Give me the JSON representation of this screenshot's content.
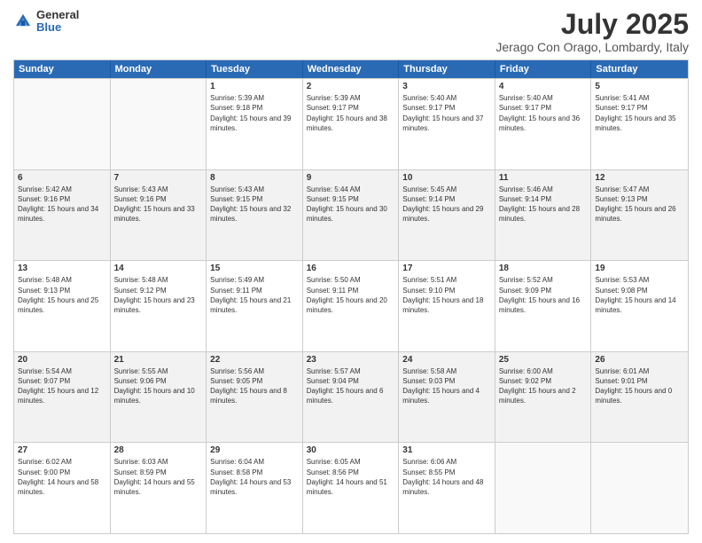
{
  "header": {
    "logo_line1": "General",
    "logo_line2": "Blue",
    "title": "July 2025",
    "subtitle": "Jerago Con Orago, Lombardy, Italy"
  },
  "weekdays": [
    "Sunday",
    "Monday",
    "Tuesday",
    "Wednesday",
    "Thursday",
    "Friday",
    "Saturday"
  ],
  "weeks": [
    [
      {
        "day": "",
        "info": ""
      },
      {
        "day": "",
        "info": ""
      },
      {
        "day": "1",
        "info": "Sunrise: 5:39 AM\nSunset: 9:18 PM\nDaylight: 15 hours and 39 minutes."
      },
      {
        "day": "2",
        "info": "Sunrise: 5:39 AM\nSunset: 9:17 PM\nDaylight: 15 hours and 38 minutes."
      },
      {
        "day": "3",
        "info": "Sunrise: 5:40 AM\nSunset: 9:17 PM\nDaylight: 15 hours and 37 minutes."
      },
      {
        "day": "4",
        "info": "Sunrise: 5:40 AM\nSunset: 9:17 PM\nDaylight: 15 hours and 36 minutes."
      },
      {
        "day": "5",
        "info": "Sunrise: 5:41 AM\nSunset: 9:17 PM\nDaylight: 15 hours and 35 minutes."
      }
    ],
    [
      {
        "day": "6",
        "info": "Sunrise: 5:42 AM\nSunset: 9:16 PM\nDaylight: 15 hours and 34 minutes."
      },
      {
        "day": "7",
        "info": "Sunrise: 5:43 AM\nSunset: 9:16 PM\nDaylight: 15 hours and 33 minutes."
      },
      {
        "day": "8",
        "info": "Sunrise: 5:43 AM\nSunset: 9:15 PM\nDaylight: 15 hours and 32 minutes."
      },
      {
        "day": "9",
        "info": "Sunrise: 5:44 AM\nSunset: 9:15 PM\nDaylight: 15 hours and 30 minutes."
      },
      {
        "day": "10",
        "info": "Sunrise: 5:45 AM\nSunset: 9:14 PM\nDaylight: 15 hours and 29 minutes."
      },
      {
        "day": "11",
        "info": "Sunrise: 5:46 AM\nSunset: 9:14 PM\nDaylight: 15 hours and 28 minutes."
      },
      {
        "day": "12",
        "info": "Sunrise: 5:47 AM\nSunset: 9:13 PM\nDaylight: 15 hours and 26 minutes."
      }
    ],
    [
      {
        "day": "13",
        "info": "Sunrise: 5:48 AM\nSunset: 9:13 PM\nDaylight: 15 hours and 25 minutes."
      },
      {
        "day": "14",
        "info": "Sunrise: 5:48 AM\nSunset: 9:12 PM\nDaylight: 15 hours and 23 minutes."
      },
      {
        "day": "15",
        "info": "Sunrise: 5:49 AM\nSunset: 9:11 PM\nDaylight: 15 hours and 21 minutes."
      },
      {
        "day": "16",
        "info": "Sunrise: 5:50 AM\nSunset: 9:11 PM\nDaylight: 15 hours and 20 minutes."
      },
      {
        "day": "17",
        "info": "Sunrise: 5:51 AM\nSunset: 9:10 PM\nDaylight: 15 hours and 18 minutes."
      },
      {
        "day": "18",
        "info": "Sunrise: 5:52 AM\nSunset: 9:09 PM\nDaylight: 15 hours and 16 minutes."
      },
      {
        "day": "19",
        "info": "Sunrise: 5:53 AM\nSunset: 9:08 PM\nDaylight: 15 hours and 14 minutes."
      }
    ],
    [
      {
        "day": "20",
        "info": "Sunrise: 5:54 AM\nSunset: 9:07 PM\nDaylight: 15 hours and 12 minutes."
      },
      {
        "day": "21",
        "info": "Sunrise: 5:55 AM\nSunset: 9:06 PM\nDaylight: 15 hours and 10 minutes."
      },
      {
        "day": "22",
        "info": "Sunrise: 5:56 AM\nSunset: 9:05 PM\nDaylight: 15 hours and 8 minutes."
      },
      {
        "day": "23",
        "info": "Sunrise: 5:57 AM\nSunset: 9:04 PM\nDaylight: 15 hours and 6 minutes."
      },
      {
        "day": "24",
        "info": "Sunrise: 5:58 AM\nSunset: 9:03 PM\nDaylight: 15 hours and 4 minutes."
      },
      {
        "day": "25",
        "info": "Sunrise: 6:00 AM\nSunset: 9:02 PM\nDaylight: 15 hours and 2 minutes."
      },
      {
        "day": "26",
        "info": "Sunrise: 6:01 AM\nSunset: 9:01 PM\nDaylight: 15 hours and 0 minutes."
      }
    ],
    [
      {
        "day": "27",
        "info": "Sunrise: 6:02 AM\nSunset: 9:00 PM\nDaylight: 14 hours and 58 minutes."
      },
      {
        "day": "28",
        "info": "Sunrise: 6:03 AM\nSunset: 8:59 PM\nDaylight: 14 hours and 55 minutes."
      },
      {
        "day": "29",
        "info": "Sunrise: 6:04 AM\nSunset: 8:58 PM\nDaylight: 14 hours and 53 minutes."
      },
      {
        "day": "30",
        "info": "Sunrise: 6:05 AM\nSunset: 8:56 PM\nDaylight: 14 hours and 51 minutes."
      },
      {
        "day": "31",
        "info": "Sunrise: 6:06 AM\nSunset: 8:55 PM\nDaylight: 14 hours and 48 minutes."
      },
      {
        "day": "",
        "info": ""
      },
      {
        "day": "",
        "info": ""
      }
    ]
  ]
}
